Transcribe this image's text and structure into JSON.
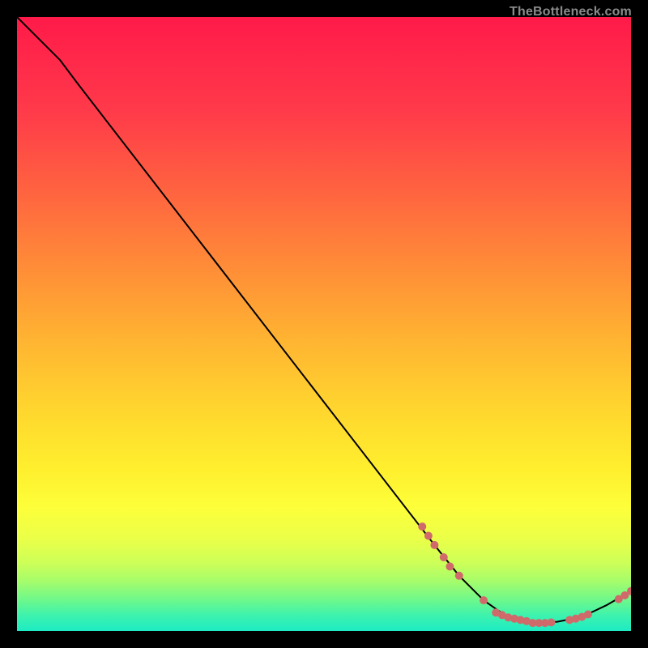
{
  "watermark": "TheBottleneck.com",
  "chart_data": {
    "type": "line",
    "title": "",
    "xlabel": "",
    "ylabel": "",
    "x_range": [
      0,
      100
    ],
    "y_range": [
      0,
      100
    ],
    "curve": [
      {
        "x": 0,
        "y": 100
      },
      {
        "x": 4,
        "y": 96
      },
      {
        "x": 7,
        "y": 93
      },
      {
        "x": 10,
        "y": 89
      },
      {
        "x": 68,
        "y": 14
      },
      {
        "x": 72,
        "y": 9
      },
      {
        "x": 76,
        "y": 5
      },
      {
        "x": 80,
        "y": 2.2
      },
      {
        "x": 84,
        "y": 1.3
      },
      {
        "x": 88,
        "y": 1.5
      },
      {
        "x": 92,
        "y": 2.3
      },
      {
        "x": 96,
        "y": 4.2
      },
      {
        "x": 100,
        "y": 6.5
      }
    ],
    "markers": [
      {
        "x": 66,
        "y": 17
      },
      {
        "x": 67,
        "y": 15.5
      },
      {
        "x": 68,
        "y": 14
      },
      {
        "x": 69.5,
        "y": 12
      },
      {
        "x": 70.5,
        "y": 10.5
      },
      {
        "x": 72,
        "y": 9
      },
      {
        "x": 76,
        "y": 5
      },
      {
        "x": 78,
        "y": 3.0
      },
      {
        "x": 79,
        "y": 2.6
      },
      {
        "x": 80,
        "y": 2.2
      },
      {
        "x": 81,
        "y": 2.0
      },
      {
        "x": 82,
        "y": 1.8
      },
      {
        "x": 83,
        "y": 1.6
      },
      {
        "x": 84,
        "y": 1.3
      },
      {
        "x": 85,
        "y": 1.3
      },
      {
        "x": 86,
        "y": 1.3
      },
      {
        "x": 87,
        "y": 1.4
      },
      {
        "x": 90,
        "y": 1.8
      },
      {
        "x": 91,
        "y": 2.0
      },
      {
        "x": 92,
        "y": 2.3
      },
      {
        "x": 93,
        "y": 2.7
      },
      {
        "x": 98,
        "y": 5.2
      },
      {
        "x": 99,
        "y": 5.8
      },
      {
        "x": 100,
        "y": 6.5
      }
    ],
    "gradient_stops": [
      {
        "offset": 0.0,
        "color": "#ff1a49"
      },
      {
        "offset": 0.15,
        "color": "#ff394a"
      },
      {
        "offset": 0.28,
        "color": "#ff6240"
      },
      {
        "offset": 0.4,
        "color": "#ff8a38"
      },
      {
        "offset": 0.52,
        "color": "#ffb232"
      },
      {
        "offset": 0.64,
        "color": "#ffd62e"
      },
      {
        "offset": 0.74,
        "color": "#fff02e"
      },
      {
        "offset": 0.8,
        "color": "#fdff3a"
      },
      {
        "offset": 0.85,
        "color": "#eaff48"
      },
      {
        "offset": 0.89,
        "color": "#ccff58"
      },
      {
        "offset": 0.92,
        "color": "#a4fc6c"
      },
      {
        "offset": 0.95,
        "color": "#6cf88c"
      },
      {
        "offset": 0.975,
        "color": "#3df2ae"
      },
      {
        "offset": 1.0,
        "color": "#1debc4"
      }
    ],
    "marker_color": "#d06a6a",
    "curve_color": "#000000"
  }
}
